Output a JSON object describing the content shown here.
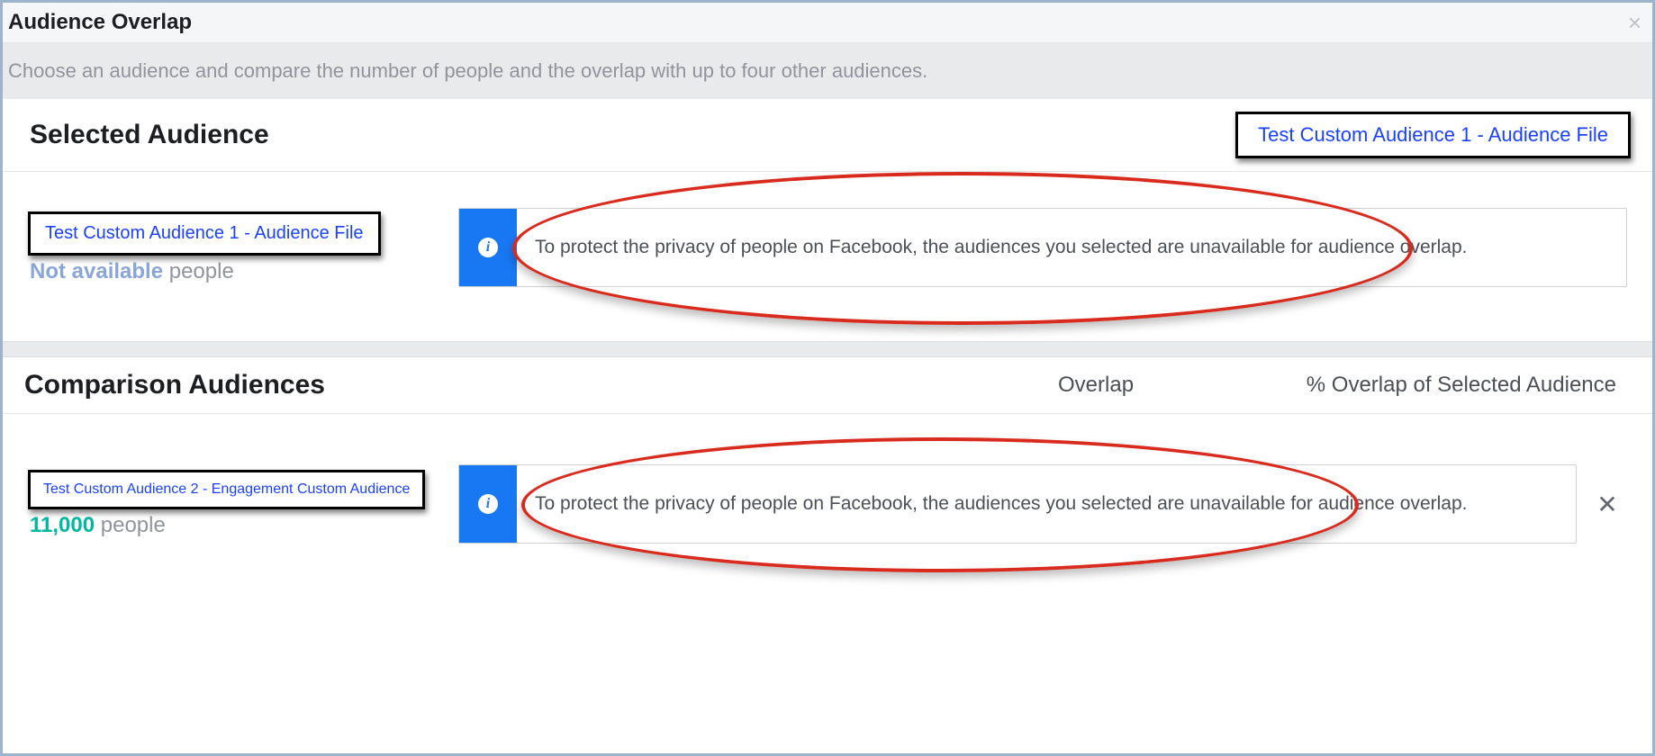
{
  "dialog": {
    "title": "Audience Overlap",
    "description": "Choose an audience and compare the number of people and the overlap with up to four other audiences."
  },
  "selected": {
    "section_title": "Selected Audience",
    "top_link_label": "Test Custom Audience 1 - Audience File",
    "audience_name": "Test Custom Audience 1 - Audience File",
    "people_count": "Not available",
    "people_word": "people",
    "privacy_message": "To protect the privacy of people on Facebook, the audiences you selected are unavailable for audience overlap."
  },
  "comparison": {
    "section_title": "Comparison Audiences",
    "col_overlap": "Overlap",
    "col_pct": "% Overlap of Selected Audience",
    "items": [
      {
        "audience_name": "Test Custom Audience 2 - Engagement Custom Audience",
        "people_count": "11,000",
        "people_word": "people",
        "privacy_message": "To protect the privacy of people on Facebook, the audiences you selected are unavailable for audience overlap."
      }
    ]
  }
}
